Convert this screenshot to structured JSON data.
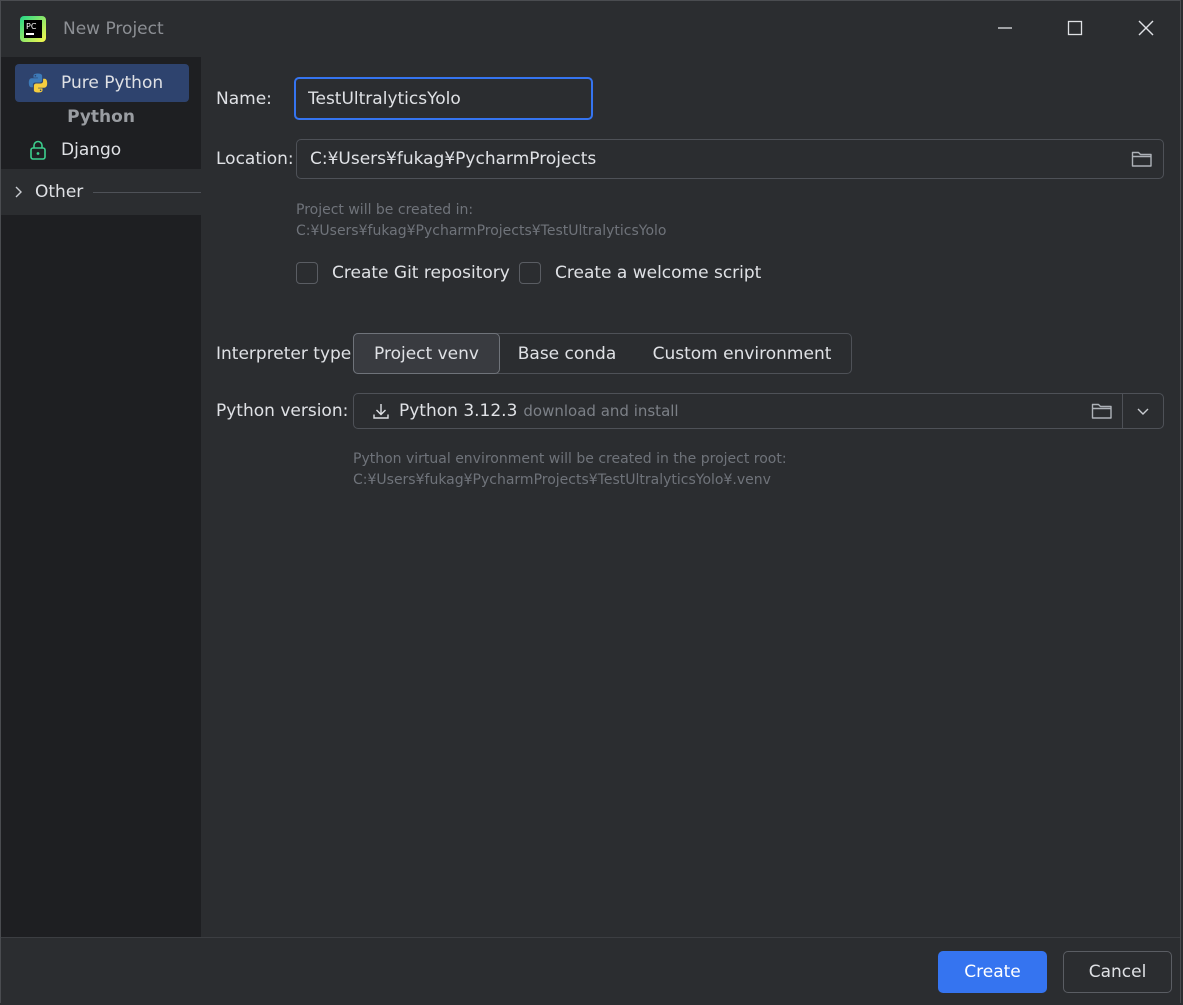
{
  "window": {
    "title": "New Project",
    "app_icon_text": "PC"
  },
  "sidebar": {
    "items": [
      {
        "label": "Pure Python",
        "icon": "python-icon",
        "selected": true
      },
      {
        "label": "Django",
        "icon": "lock-icon",
        "selected": false
      }
    ],
    "group_label": "Python",
    "other_label": "Other"
  },
  "form": {
    "name_label": "Name:",
    "name_value": "TestUltralyticsYolo",
    "location_label": "Location:",
    "location_value": "C:¥Users¥fukag¥PycharmProjects",
    "project_hint_line1": "Project will be created in:",
    "project_hint_line2": "C:¥Users¥fukag¥PycharmProjects¥TestUltralyticsYolo",
    "git_checkbox_label": "Create Git repository",
    "git_checked": false,
    "welcome_checkbox_label": "Create a welcome script",
    "welcome_checked": false,
    "interpreter_label": "Interpreter type:",
    "interpreter_options": [
      "Project venv",
      "Base conda",
      "Custom environment"
    ],
    "interpreter_selected": "Project venv",
    "python_version_label": "Python version:",
    "python_version_value": "Python 3.12.3",
    "python_version_note": "download and install",
    "venv_hint_line1": "Python virtual environment will be created in the project root:",
    "venv_hint_line2": "C:¥Users¥fukag¥PycharmProjects¥TestUltralyticsYolo¥.venv"
  },
  "footer": {
    "create_label": "Create",
    "cancel_label": "Cancel"
  },
  "colors": {
    "accent": "#3574f0",
    "background": "#2b2d30",
    "sidebar": "#1e1f22",
    "selection": "#2e436e"
  }
}
